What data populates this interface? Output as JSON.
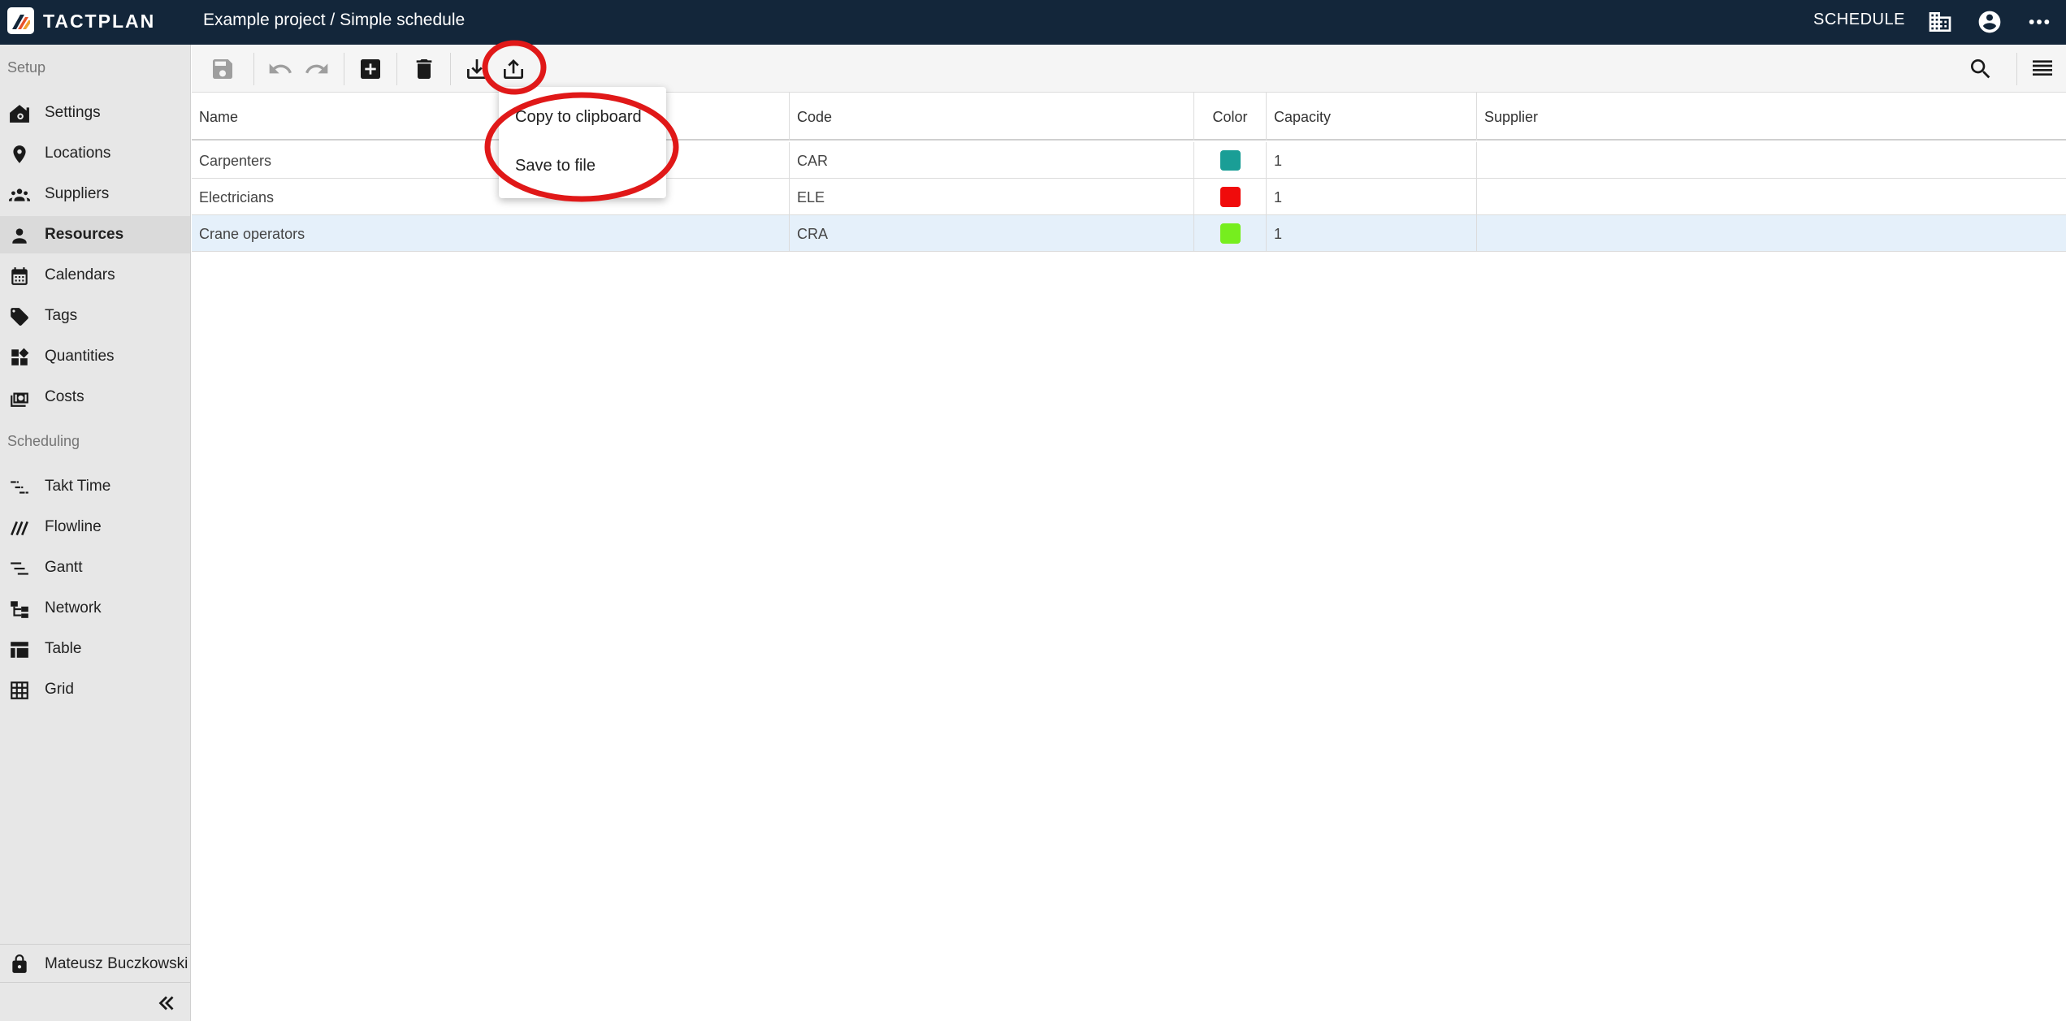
{
  "app": {
    "logo_text": "TACTPLAN",
    "title": "Example project / Simple schedule",
    "schedule_label": "SCHEDULE"
  },
  "sidebar": {
    "setup_label": "Setup",
    "setup_items": [
      {
        "label": "Settings",
        "icon": "home-gear-icon"
      },
      {
        "label": "Locations",
        "icon": "location-pin-icon"
      },
      {
        "label": "Suppliers",
        "icon": "group-icon"
      },
      {
        "label": "Resources",
        "icon": "person-icon",
        "active": true
      },
      {
        "label": "Calendars",
        "icon": "calendar-icon"
      },
      {
        "label": "Tags",
        "icon": "tag-icon"
      },
      {
        "label": "Quantities",
        "icon": "widgets-icon"
      },
      {
        "label": "Costs",
        "icon": "money-icon"
      }
    ],
    "scheduling_label": "Scheduling",
    "scheduling_items": [
      {
        "label": "Takt Time",
        "icon": "takt-time-icon"
      },
      {
        "label": "Flowline",
        "icon": "flowline-icon"
      },
      {
        "label": "Gantt",
        "icon": "gantt-icon"
      },
      {
        "label": "Network",
        "icon": "network-icon"
      },
      {
        "label": "Table",
        "icon": "table-icon"
      },
      {
        "label": "Grid",
        "icon": "grid-icon"
      }
    ],
    "user_name": "Mateusz Buczkowski"
  },
  "toolbar": {
    "buttons": [
      "save-icon",
      "undo-icon",
      "redo-icon",
      "add-icon",
      "delete-icon",
      "import-icon",
      "export-icon",
      "search-icon",
      "columns-menu-icon"
    ]
  },
  "table": {
    "columns": [
      "Name",
      "Code",
      "Color",
      "Capacity",
      "Supplier"
    ],
    "rows": [
      {
        "name": "Carpenters",
        "code": "CAR",
        "color": "#1a9e96",
        "capacity": "1",
        "supplier": ""
      },
      {
        "name": "Electricians",
        "code": "ELE",
        "color": "#f00b0b",
        "capacity": "1",
        "supplier": ""
      },
      {
        "name": "Crane operators",
        "code": "CRA",
        "color": "#76ee1e",
        "capacity": "1",
        "supplier": "",
        "selected": true
      }
    ]
  },
  "export_menu": {
    "items": [
      "Copy to clipboard",
      "Save to file"
    ]
  },
  "colors": {
    "topbar": "#13263a",
    "sidebar": "#e7e7e7",
    "selected_row": "#e5f0fa",
    "annotation": "#e01818"
  }
}
